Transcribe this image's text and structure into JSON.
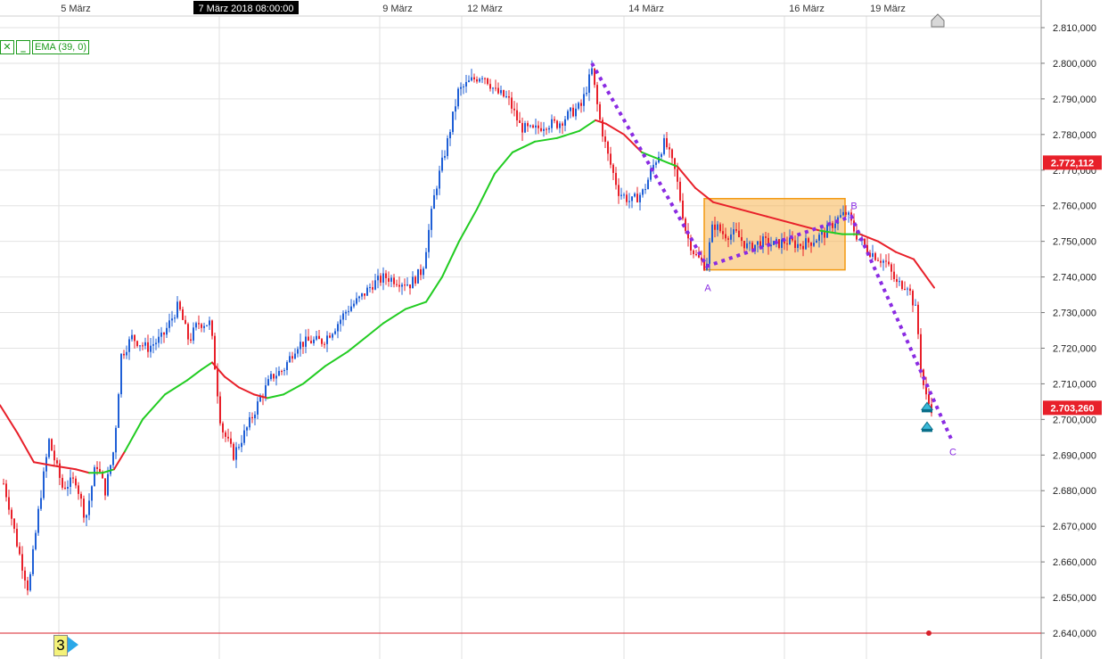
{
  "chart_data": {
    "type": "candlestick",
    "xlabels": [
      "5 März",
      "7 März 2018 08:00:00",
      "9 März",
      "12 März",
      "14 März",
      "16 März",
      "19 März"
    ],
    "ylim": [
      2640,
      2810
    ],
    "yticks": [
      "2.810,000",
      "2.800,000",
      "2.790,000",
      "2.780,000",
      "2.770,000",
      "2.760,000",
      "2.750,000",
      "2.740,000",
      "2.730,000",
      "2.720,000",
      "2.710,000",
      "2.700,000",
      "2.690,000",
      "2.680,000",
      "2.670,000",
      "2.660,000",
      "2.650,000",
      "2.640,000"
    ],
    "ytick_values": [
      2810,
      2800,
      2790,
      2780,
      2770,
      2760,
      2750,
      2740,
      2730,
      2720,
      2710,
      2700,
      2690,
      2680,
      2670,
      2660,
      2650,
      2640
    ],
    "price_labels": [
      {
        "text": "2.772,112",
        "value": 2772.112,
        "color": "#e8202a"
      },
      {
        "text": "2.703,260",
        "value": 2703.26,
        "color": "#e8202a"
      }
    ],
    "indicator": {
      "label": "EMA (39, 0)",
      "up_color": "#22cc22",
      "down_color": "#e8202a"
    },
    "pattern_labels": [
      "A",
      "B",
      "C"
    ],
    "anchors": [
      [
        0,
        2686
      ],
      [
        10,
        2676
      ],
      [
        20,
        2664
      ],
      [
        32,
        2652
      ],
      [
        44,
        2676
      ],
      [
        55,
        2694
      ],
      [
        70,
        2681
      ],
      [
        85,
        2683
      ],
      [
        96,
        2672
      ],
      [
        108,
        2688
      ],
      [
        118,
        2680
      ],
      [
        128,
        2692
      ],
      [
        136,
        2718
      ],
      [
        148,
        2723
      ],
      [
        165,
        2720
      ],
      [
        182,
        2723
      ],
      [
        200,
        2732
      ],
      [
        212,
        2722
      ],
      [
        222,
        2727
      ],
      [
        236,
        2727
      ],
      [
        248,
        2698
      ],
      [
        262,
        2690
      ],
      [
        278,
        2698
      ],
      [
        292,
        2706
      ],
      [
        305,
        2712
      ],
      [
        318,
        2714
      ],
      [
        333,
        2721
      ],
      [
        348,
        2722
      ],
      [
        362,
        2722
      ],
      [
        376,
        2726
      ],
      [
        390,
        2731
      ],
      [
        404,
        2734
      ],
      [
        418,
        2738
      ],
      [
        432,
        2740
      ],
      [
        446,
        2739
      ],
      [
        460,
        2738
      ],
      [
        474,
        2742
      ],
      [
        488,
        2764
      ],
      [
        502,
        2778
      ],
      [
        514,
        2792
      ],
      [
        528,
        2795
      ],
      [
        542,
        2797
      ],
      [
        556,
        2792
      ],
      [
        570,
        2790
      ],
      [
        584,
        2782
      ],
      [
        598,
        2781
      ],
      [
        612,
        2783
      ],
      [
        626,
        2783
      ],
      [
        640,
        2786
      ],
      [
        652,
        2788
      ],
      [
        664,
        2798
      ],
      [
        672,
        2785
      ],
      [
        682,
        2774
      ],
      [
        694,
        2764
      ],
      [
        708,
        2761
      ],
      [
        722,
        2764
      ],
      [
        734,
        2772
      ],
      [
        746,
        2778
      ],
      [
        758,
        2769
      ],
      [
        770,
        2752
      ],
      [
        780,
        2746
      ],
      [
        792,
        2743
      ],
      [
        800,
        2755
      ],
      [
        812,
        2752
      ],
      [
        826,
        2752
      ],
      [
        840,
        2748
      ],
      [
        854,
        2750
      ],
      [
        868,
        2749
      ],
      [
        882,
        2750
      ],
      [
        896,
        2749
      ],
      [
        910,
        2750
      ],
      [
        924,
        2752
      ],
      [
        938,
        2756
      ],
      [
        950,
        2758
      ],
      [
        960,
        2752
      ],
      [
        972,
        2748
      ],
      [
        982,
        2746
      ],
      [
        994,
        2744
      ],
      [
        1006,
        2738
      ],
      [
        1018,
        2738
      ],
      [
        1028,
        2730
      ],
      [
        1034,
        2712
      ],
      [
        1040,
        2705
      ],
      [
        1046,
        2703
      ]
    ],
    "ema_points": [
      [
        0,
        2704
      ],
      [
        20,
        2696
      ],
      [
        38,
        2688
      ],
      [
        60,
        2687
      ],
      [
        85,
        2686
      ],
      [
        100,
        2685
      ],
      [
        115,
        2685
      ],
      [
        128,
        2686
      ],
      [
        140,
        2691
      ],
      [
        160,
        2700
      ],
      [
        185,
        2707
      ],
      [
        210,
        2711
      ],
      [
        226,
        2714
      ],
      [
        238,
        2716
      ],
      [
        252,
        2712
      ],
      [
        268,
        2709
      ],
      [
        285,
        2707
      ],
      [
        300,
        2706
      ],
      [
        318,
        2707
      ],
      [
        340,
        2710
      ],
      [
        365,
        2715
      ],
      [
        390,
        2719
      ],
      [
        410,
        2723
      ],
      [
        430,
        2727
      ],
      [
        455,
        2731
      ],
      [
        478,
        2733
      ],
      [
        496,
        2740
      ],
      [
        515,
        2750
      ],
      [
        535,
        2759
      ],
      [
        555,
        2769
      ],
      [
        575,
        2775
      ],
      [
        600,
        2778
      ],
      [
        625,
        2779
      ],
      [
        650,
        2781
      ],
      [
        668,
        2784
      ],
      [
        680,
        2783
      ],
      [
        700,
        2780
      ],
      [
        720,
        2775
      ],
      [
        740,
        2773
      ],
      [
        760,
        2771
      ],
      [
        780,
        2765
      ],
      [
        800,
        2761
      ],
      [
        830,
        2759
      ],
      [
        860,
        2757
      ],
      [
        890,
        2755
      ],
      [
        920,
        2753
      ],
      [
        945,
        2752
      ],
      [
        965,
        2752
      ],
      [
        985,
        2750
      ],
      [
        1005,
        2747
      ],
      [
        1025,
        2745
      ],
      [
        1048,
        2737
      ]
    ],
    "ema_green_ranges": [
      [
        96,
        128
      ],
      [
        150,
        238
      ],
      [
        300,
        668
      ],
      [
        722,
        752
      ],
      [
        920,
        955
      ]
    ],
    "zigzag": [
      [
        664,
        2800
      ],
      [
        793,
        2743
      ],
      [
        955,
        2757
      ],
      [
        1068,
        2694
      ]
    ],
    "rect": {
      "x0": 790,
      "x1": 948,
      "y0": 2762,
      "y1": 2742
    },
    "markers": [
      {
        "x": 1040,
        "value": 2703.5
      },
      {
        "x": 1040,
        "value": 2698
      }
    ],
    "red_line_value": 2640,
    "home_icon": "house-icon"
  },
  "badge": {
    "text": "3"
  }
}
